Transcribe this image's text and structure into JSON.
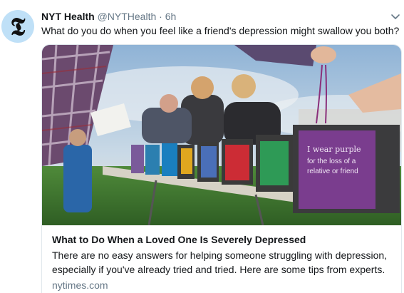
{
  "tweet": {
    "avatar_icon": "nyt-t-logo",
    "avatar_glyph": "𝕿",
    "author_name": "NYT Health",
    "handle": "@NYTHealth",
    "separator": "·",
    "time": "6h",
    "menu_icon": "chevron-down-icon",
    "text": "What do you do when you feel like a friend's depression might swallow you both?"
  },
  "card": {
    "image_description_icon": "photo",
    "sign_text_1": "I wear purple",
    "sign_text_2": "for the loss of a",
    "sign_text_3": "relative or friend",
    "title": "What to Do When a Loved One Is Severely Depressed",
    "description": "There are no easy answers for helping someone struggling with depression, especially if you've already tried and tried. Here are some tips from experts.",
    "domain": "nytimes.com"
  },
  "colors": {
    "avatar_bg": "#bfe0f7",
    "secondary_text": "#657786",
    "border": "#e1e8ed"
  }
}
